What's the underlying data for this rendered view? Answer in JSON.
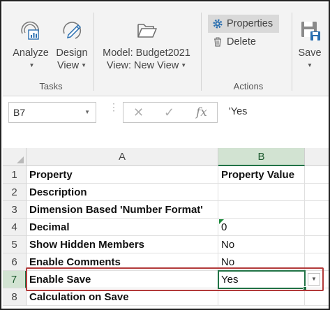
{
  "ribbon": {
    "analyze": "Analyze",
    "design_view": [
      "Design",
      "View"
    ],
    "model": "Model: Budget2021",
    "new_view": "View: New View",
    "properties": "Properties",
    "delete": "Delete",
    "save": "Save",
    "groups": {
      "tasks": "Tasks",
      "actions": "Actions"
    }
  },
  "formula_bar": {
    "name_box": "B7",
    "cancel_glyph": "✕",
    "enter_glyph": "✓",
    "fx_glyph": "fx",
    "value": "'Yes"
  },
  "grid": {
    "columns": [
      "A",
      "B"
    ],
    "rows": [
      {
        "num": "1",
        "a": "Property",
        "b": "Property Value"
      },
      {
        "num": "2",
        "a": "Description",
        "b": ""
      },
      {
        "num": "3",
        "a": "Dimension Based 'Number Format'",
        "b": ""
      },
      {
        "num": "4",
        "a": "Decimal",
        "b": "0"
      },
      {
        "num": "5",
        "a": "Show Hidden Members",
        "b": "No"
      },
      {
        "num": "6",
        "a": "Enable Comments",
        "b": "No"
      },
      {
        "num": "7",
        "a": "Enable Save",
        "b": "Yes"
      },
      {
        "num": "8",
        "a": "Calculation on Save",
        "b": ""
      }
    ],
    "active_cell": "B7"
  },
  "colors": {
    "excel_green": "#217346",
    "highlight_red": "#b23a3a"
  }
}
